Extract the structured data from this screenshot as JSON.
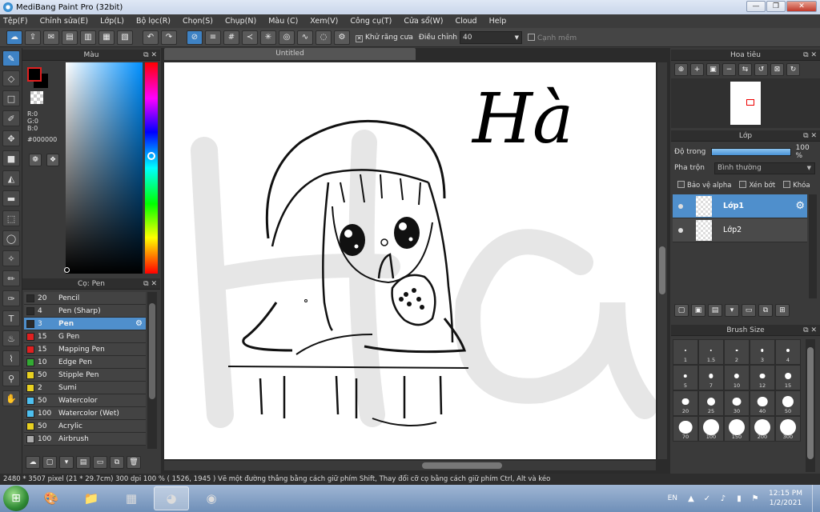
{
  "window": {
    "title": "MediBang Paint Pro (32bit)",
    "minimize": "—",
    "restore": "❐",
    "close": "✕"
  },
  "menu": [
    "Tệp(F)",
    "Chỉnh sửa(E)",
    "Lớp(L)",
    "Bộ lọc(R)",
    "Chọn(S)",
    "Chụp(N)",
    "Màu (C)",
    "Xem(V)",
    "Công cụ(T)",
    "Cửa sổ(W)",
    "Cloud",
    "Help"
  ],
  "toolbar": {
    "antialias_label": "Khử răng cưa",
    "antialias_checked": "✕",
    "adjust_label": "Điều chỉnh",
    "adjust_value": "40",
    "soft_edge_label": "Cạnh mềm"
  },
  "color_panel": {
    "title": "Màu",
    "r": "R:0",
    "g": "G:0",
    "b": "B:0",
    "hex": "#000000",
    "fg_color": "#000000",
    "bg_color": "#000000"
  },
  "brush_panel": {
    "title": "Cọ: Pen",
    "brushes": [
      {
        "size": "20",
        "name": "Pencil",
        "color": "#2a2a2a"
      },
      {
        "size": "4",
        "name": "Pen (Sharp)",
        "color": "#2a2a2a"
      },
      {
        "size": "3",
        "name": "Pen",
        "color": "#2a2a2a",
        "selected": true
      },
      {
        "size": "15",
        "name": "G Pen",
        "color": "#e02020"
      },
      {
        "size": "15",
        "name": "Mapping Pen",
        "color": "#e02020"
      },
      {
        "size": "10",
        "name": "Edge Pen",
        "color": "#33aa33"
      },
      {
        "size": "50",
        "name": "Stipple Pen",
        "color": "#e8d020"
      },
      {
        "size": "2",
        "name": "Sumi",
        "color": "#e8d020"
      },
      {
        "size": "50",
        "name": "Watercolor",
        "color": "#4ec0f0"
      },
      {
        "size": "100",
        "name": "Watercolor (Wet)",
        "color": "#4ec0f0"
      },
      {
        "size": "50",
        "name": "Acrylic",
        "color": "#e8d020"
      },
      {
        "size": "100",
        "name": "Airbrush",
        "color": "#aaaaaa"
      }
    ]
  },
  "canvas": {
    "tab_title": "Untitled",
    "handwriting": "Hà"
  },
  "navigator": {
    "title": "Hoa tiêu"
  },
  "layer_panel": {
    "title": "Lớp",
    "opacity_label": "Độ trong",
    "opacity_value": "100 %",
    "blend_label": "Pha trộn",
    "blend_value": "Bình thường",
    "protect_alpha": "Bảo vệ alpha",
    "clipping": "Xén bớt",
    "lock": "Khóa",
    "layers": [
      {
        "name": "Lớp1",
        "selected": true
      },
      {
        "name": "Lớp2",
        "selected": false
      }
    ]
  },
  "brush_size_panel": {
    "title": "Brush Size",
    "sizes": [
      "1",
      "1.5",
      "2",
      "3",
      "4",
      "5",
      "7",
      "10",
      "12",
      "15",
      "20",
      "25",
      "30",
      "40",
      "50",
      "70",
      "100",
      "150",
      "200",
      "300"
    ]
  },
  "statusbar": {
    "text": "2480 * 3507 pixel   (21 * 29.7cm)   300 dpi   100 %   ( 1526, 1945 )   Vẽ một đường thẳng bằng cách giữ phím Shift, Thay đổi cỡ cọ bằng cách giữ phím Ctrl, Alt và kéo"
  },
  "taskbar": {
    "lang": "EN",
    "time": "12:15 PM",
    "date": "1/2/2021"
  }
}
